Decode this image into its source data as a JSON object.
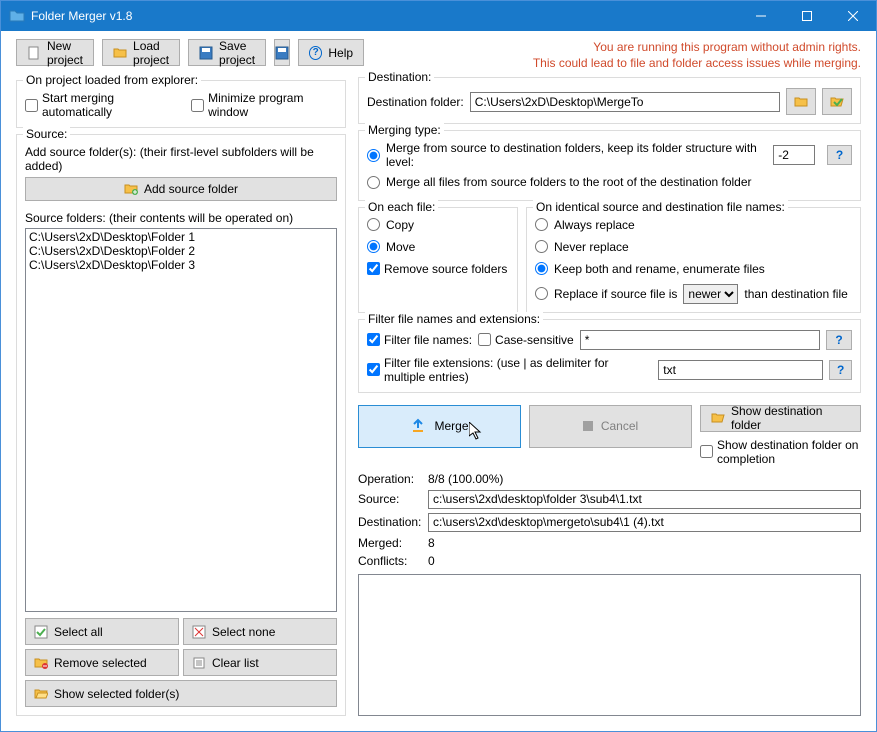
{
  "title": "Folder Merger v1.8",
  "toolbar": {
    "new_project": "New project",
    "load_project": "Load project",
    "save_project": "Save project",
    "help": "Help"
  },
  "admin_warning_l1": "You are running this program without admin rights.",
  "admin_warning_l2": "This could lead to file and folder access issues while merging.",
  "onload_group": {
    "legend": "On project loaded from explorer:",
    "start_auto": "Start merging automatically",
    "min_window": "Minimize program window"
  },
  "source_group": {
    "legend": "Source:",
    "add_hint": "Add source folder(s): (their first-level subfolders will be added)",
    "add_btn": "Add source folder",
    "list_label": "Source folders: (their contents will be operated on)",
    "items": [
      "C:\\Users\\2xD\\Desktop\\Folder 1",
      "C:\\Users\\2xD\\Desktop\\Folder 2",
      "C:\\Users\\2xD\\Desktop\\Folder 3"
    ],
    "select_all": "Select all",
    "select_none": "Select none",
    "remove_selected": "Remove selected",
    "clear_list": "Clear list",
    "show_selected": "Show selected folder(s)"
  },
  "dest_group": {
    "legend": "Destination:",
    "label": "Destination folder:",
    "path": "C:\\Users\\2xD\\Desktop\\MergeTo"
  },
  "merge_type": {
    "legend": "Merging type:",
    "opt1": "Merge from source to destination folders, keep its folder structure with level:",
    "opt1_value": "-2",
    "opt2": "Merge all files from source folders to the root of the destination folder"
  },
  "each_file": {
    "legend": "On each file:",
    "copy": "Copy",
    "move": "Move",
    "remove": "Remove source folders"
  },
  "identical": {
    "legend": "On identical source and destination file names:",
    "always": "Always replace",
    "never": "Never replace",
    "keep": "Keep both and rename, enumerate files",
    "replace_if": "Replace if source file is",
    "cmp": "newer",
    "than": "than destination file"
  },
  "filter": {
    "legend": "Filter file names and extensions:",
    "names": "Filter file names:",
    "case": "Case-sensitive",
    "names_value": "*",
    "ext": "Filter file extensions: (use | as delimiter for multiple entries)",
    "ext_value": "txt"
  },
  "actions": {
    "merge": "Merge",
    "cancel": "Cancel",
    "show_dest": "Show destination folder",
    "show_on_complete": "Show destination folder on completion"
  },
  "status": {
    "operation_label": "Operation:",
    "operation_value": "8/8 (100.00%)",
    "source_label": "Source:",
    "source_value": "c:\\users\\2xd\\desktop\\folder 3\\sub4\\1.txt",
    "dest_label": "Destination:",
    "dest_value": "c:\\users\\2xd\\desktop\\mergeto\\sub4\\1 (4).txt",
    "merged_label": "Merged:",
    "merged_value": "8",
    "conflicts_label": "Conflicts:",
    "conflicts_value": "0"
  }
}
